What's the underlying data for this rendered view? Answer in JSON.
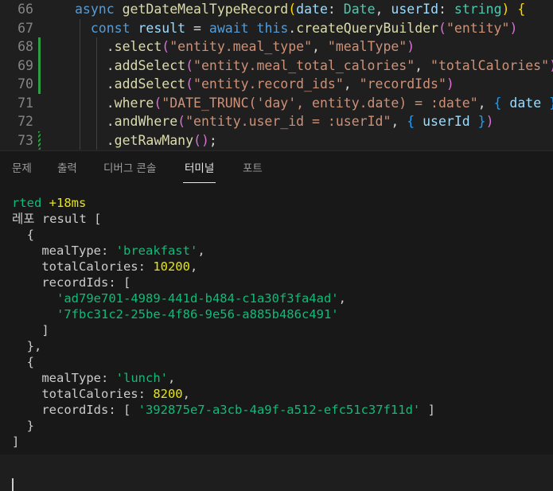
{
  "editor": {
    "lines": [
      {
        "num": "66",
        "code": [
          {
            "t": "async ",
            "c": "kw"
          },
          {
            "t": "getDateMealTypeRecord",
            "c": "fn"
          },
          {
            "t": "(",
            "c": "b1"
          },
          {
            "t": "date",
            "c": "var"
          },
          {
            "t": ": ",
            "c": ""
          },
          {
            "t": "Date",
            "c": "typ"
          },
          {
            "t": ", ",
            "c": ""
          },
          {
            "t": "userId",
            "c": "var"
          },
          {
            "t": ": ",
            "c": ""
          },
          {
            "t": "string",
            "c": "typ"
          },
          {
            "t": ")",
            "c": "b1"
          },
          {
            "t": " ",
            "c": ""
          },
          {
            "t": "{",
            "c": "b1"
          }
        ]
      },
      {
        "num": "67",
        "code": [
          {
            "t": "  const ",
            "c": "kw"
          },
          {
            "t": "result",
            "c": "var"
          },
          {
            "t": " = ",
            "c": ""
          },
          {
            "t": "await ",
            "c": "kw"
          },
          {
            "t": "this",
            "c": "kw"
          },
          {
            "t": ".",
            "c": ""
          },
          {
            "t": "createQueryBuilder",
            "c": "fn"
          },
          {
            "t": "(",
            "c": "b2"
          },
          {
            "t": "\"entity\"",
            "c": "str"
          },
          {
            "t": ")",
            "c": "b2"
          }
        ]
      },
      {
        "num": "68",
        "changed": "solid",
        "code": [
          {
            "t": "    .",
            "c": ""
          },
          {
            "t": "select",
            "c": "fn"
          },
          {
            "t": "(",
            "c": "b2"
          },
          {
            "t": "\"entity.meal_type\"",
            "c": "str"
          },
          {
            "t": ", ",
            "c": ""
          },
          {
            "t": "\"mealType\"",
            "c": "str"
          },
          {
            "t": ")",
            "c": "b2"
          }
        ]
      },
      {
        "num": "69",
        "changed": "solid",
        "code": [
          {
            "t": "    .",
            "c": ""
          },
          {
            "t": "addSelect",
            "c": "fn"
          },
          {
            "t": "(",
            "c": "b2"
          },
          {
            "t": "\"entity.meal_total_calories\"",
            "c": "str"
          },
          {
            "t": ", ",
            "c": ""
          },
          {
            "t": "\"totalCalories\"",
            "c": "str"
          },
          {
            "t": ")",
            "c": "b2"
          }
        ]
      },
      {
        "num": "70",
        "changed": "solid",
        "code": [
          {
            "t": "    .",
            "c": ""
          },
          {
            "t": "addSelect",
            "c": "fn"
          },
          {
            "t": "(",
            "c": "b2"
          },
          {
            "t": "\"entity.record_ids\"",
            "c": "str"
          },
          {
            "t": ", ",
            "c": ""
          },
          {
            "t": "\"recordIds\"",
            "c": "str"
          },
          {
            "t": ")",
            "c": "b2"
          }
        ]
      },
      {
        "num": "71",
        "code": [
          {
            "t": "    .",
            "c": ""
          },
          {
            "t": "where",
            "c": "fn"
          },
          {
            "t": "(",
            "c": "b2"
          },
          {
            "t": "\"DATE_TRUNC('day', entity.date) = :date\"",
            "c": "str"
          },
          {
            "t": ", ",
            "c": ""
          },
          {
            "t": "{",
            "c": "b3"
          },
          {
            "t": " ",
            "c": ""
          },
          {
            "t": "date",
            "c": "var"
          },
          {
            "t": " ",
            "c": ""
          },
          {
            "t": "}",
            "c": "b3"
          },
          {
            "t": ")",
            "c": "b2"
          }
        ]
      },
      {
        "num": "72",
        "code": [
          {
            "t": "    .",
            "c": ""
          },
          {
            "t": "andWhere",
            "c": "fn"
          },
          {
            "t": "(",
            "c": "b2"
          },
          {
            "t": "\"entity.user_id = :userId\"",
            "c": "str"
          },
          {
            "t": ", ",
            "c": ""
          },
          {
            "t": "{",
            "c": "b3"
          },
          {
            "t": " ",
            "c": ""
          },
          {
            "t": "userId",
            "c": "var"
          },
          {
            "t": " ",
            "c": ""
          },
          {
            "t": "}",
            "c": "b3"
          },
          {
            "t": ")",
            "c": "b2"
          }
        ]
      },
      {
        "num": "73",
        "changed": "dotted",
        "code": [
          {
            "t": "    .",
            "c": ""
          },
          {
            "t": "getRawMany",
            "c": "fn"
          },
          {
            "t": "(",
            "c": "b2"
          },
          {
            "t": ")",
            "c": "b2"
          },
          {
            "t": ";",
            "c": ""
          }
        ]
      }
    ]
  },
  "panel": {
    "tabs": [
      {
        "label": "문제",
        "active": false
      },
      {
        "label": "출력",
        "active": false
      },
      {
        "label": "디버그 콘솔",
        "active": false
      },
      {
        "label": "터미널",
        "active": true
      },
      {
        "label": "포트",
        "active": false
      }
    ]
  },
  "terminal": {
    "lines": [
      [
        {
          "t": "rted ",
          "c": "t-green"
        },
        {
          "t": "+18ms",
          "c": "t-yellow"
        }
      ],
      [
        {
          "t": "레포 result [",
          "c": ""
        }
      ],
      [
        {
          "t": "  {",
          "c": ""
        }
      ],
      [
        {
          "t": "    mealType: ",
          "c": ""
        },
        {
          "t": "'breakfast'",
          "c": "t-green"
        },
        {
          "t": ",",
          "c": ""
        }
      ],
      [
        {
          "t": "    totalCalories: ",
          "c": ""
        },
        {
          "t": "10200",
          "c": "t-yellow"
        },
        {
          "t": ",",
          "c": ""
        }
      ],
      [
        {
          "t": "    recordIds: [",
          "c": ""
        }
      ],
      [
        {
          "t": "      ",
          "c": ""
        },
        {
          "t": "'ad79e701-4989-441d-b484-c1a30f3fa4ad'",
          "c": "t-green"
        },
        {
          "t": ",",
          "c": ""
        }
      ],
      [
        {
          "t": "      ",
          "c": ""
        },
        {
          "t": "'7fbc31c2-25be-4f86-9e56-a885b486c491'",
          "c": "t-green"
        }
      ],
      [
        {
          "t": "    ]",
          "c": ""
        }
      ],
      [
        {
          "t": "  },",
          "c": ""
        }
      ],
      [
        {
          "t": "  {",
          "c": ""
        }
      ],
      [
        {
          "t": "    mealType: ",
          "c": ""
        },
        {
          "t": "'lunch'",
          "c": "t-green"
        },
        {
          "t": ",",
          "c": ""
        }
      ],
      [
        {
          "t": "    totalCalories: ",
          "c": ""
        },
        {
          "t": "8200",
          "c": "t-yellow"
        },
        {
          "t": ",",
          "c": ""
        }
      ],
      [
        {
          "t": "    recordIds: [ ",
          "c": ""
        },
        {
          "t": "'392875e7-a3cb-4a9f-a512-efc51c37f11d'",
          "c": "t-green"
        },
        {
          "t": " ]",
          "c": ""
        }
      ],
      [
        {
          "t": "  }",
          "c": ""
        }
      ],
      [
        {
          "t": "]",
          "c": ""
        }
      ]
    ]
  }
}
